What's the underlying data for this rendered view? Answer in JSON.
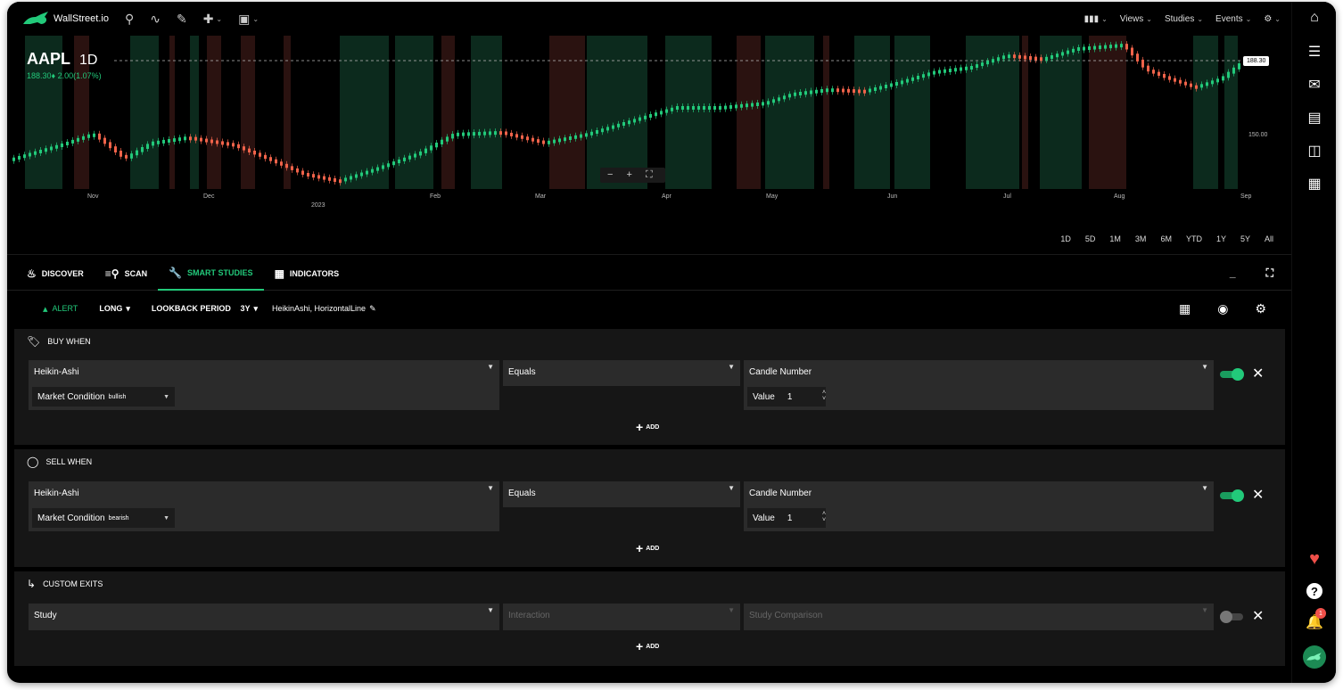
{
  "app": {
    "brand": "WallStreet.io"
  },
  "toolbar": {
    "views": "Views",
    "studies": "Studies",
    "events": "Events"
  },
  "chart": {
    "symbol": "AAPL",
    "timeframe": "1D",
    "quote": "188.30♦ 2.00(1.07%)",
    "last_price": "188.30",
    "price_level": "150.00",
    "months": [
      "Nov",
      "Dec",
      "Feb",
      "Mar",
      "Apr",
      "May",
      "Jun",
      "Jul",
      "Aug",
      "Sep"
    ],
    "year_label": "2023",
    "zoom_controls": "− + ⛶"
  },
  "ranges": [
    "1D",
    "5D",
    "1M",
    "3M",
    "6M",
    "YTD",
    "1Y",
    "5Y",
    "All"
  ],
  "tabs": [
    {
      "label": "DISCOVER",
      "icon": "fire-icon"
    },
    {
      "label": "SCAN",
      "icon": "scan-icon"
    },
    {
      "label": "SMART STUDIES",
      "icon": "wrench-icon"
    },
    {
      "label": "INDICATORS",
      "icon": "indicators-icon"
    }
  ],
  "subbar": {
    "alert": "ALERT",
    "direction": "LONG",
    "lookback_label": "LOOKBACK PERIOD",
    "lookback_value": "3Y",
    "studies_list": "HeikinAshi, HorizontalLine"
  },
  "buy": {
    "title": "BUY WHEN",
    "study": "Heikin-Ashi",
    "condition_label": "Market Condition",
    "condition_value": "bullish",
    "interaction": "Equals",
    "comparison": "Candle Number",
    "value_label": "Value",
    "value": "1",
    "add": "ADD",
    "enabled": true
  },
  "sell": {
    "title": "SELL WHEN",
    "study": "Heikin-Ashi",
    "condition_label": "Market Condition",
    "condition_value": "bearish",
    "interaction": "Equals",
    "comparison": "Candle Number",
    "value_label": "Value",
    "value": "1",
    "add": "ADD",
    "enabled": true
  },
  "exits": {
    "title": "CUSTOM EXITS",
    "study": "Study",
    "interaction": "Interaction",
    "comparison": "Study Comparison",
    "add": "ADD",
    "enabled": false
  },
  "notifications": {
    "count": "1"
  },
  "colors": {
    "up": "#22c97a",
    "down": "#f0634a",
    "panel": "#161616",
    "field": "#2b2b2b"
  }
}
